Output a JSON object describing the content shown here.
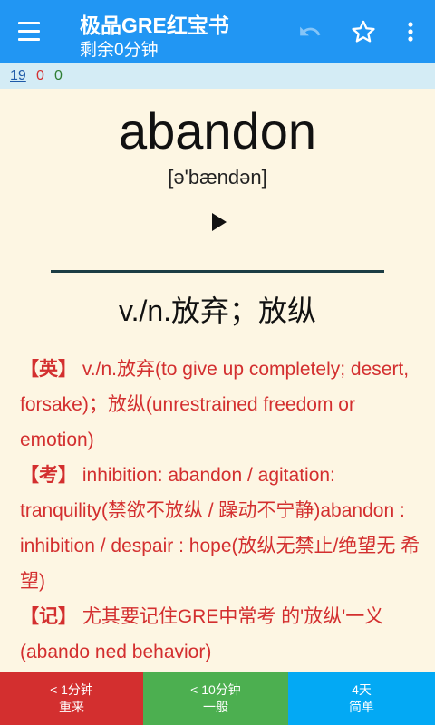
{
  "appbar": {
    "title": "极品GRE红宝书",
    "subtitle": "剩余0分钟",
    "icons": [
      "menu-icon",
      "undo-icon",
      "star-outline-icon",
      "more-vert-icon"
    ]
  },
  "status": {
    "count_blue": "19",
    "count_red": "0",
    "count_green": "0"
  },
  "card": {
    "word": "abandon",
    "phonetic": "[ə'bændən]",
    "meaning": "v./n.放弃；放纵",
    "en_tag": "【英】",
    "en_text": "v./n.放弃(to give up completely; desert, forsake)；放纵(unrestrained freedom or emotion)",
    "exam_tag": "【考】",
    "exam_text": "inhibition: abandon / agitation: tranquility(禁欲不放纵 / 躁动不宁静)abandon : inhibition / despair : hope(放纵无禁止/绝望无 希望)",
    "memo_tag": "【记】",
    "memo_text": "尤其要记住GRE中常考 的'放纵'一义(abando ned behavior)"
  },
  "buttons": [
    {
      "time": "< 1分钟",
      "label": "重来"
    },
    {
      "time": "< 10分钟",
      "label": "一般"
    },
    {
      "time": "4天",
      "label": "简单"
    }
  ],
  "colors": {
    "appbar": "#2196f3",
    "background": "#fdf6e3",
    "detail_text": "#d32f2f",
    "again": "#d32f2f",
    "good": "#4caf50",
    "easy": "#03a9f4"
  }
}
